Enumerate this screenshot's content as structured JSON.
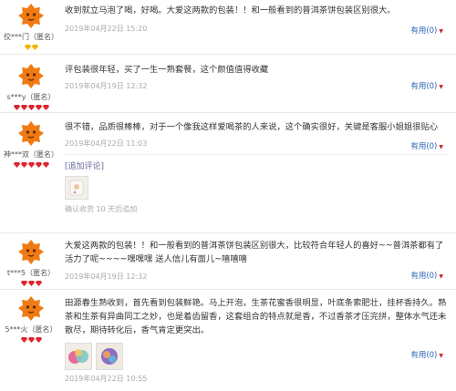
{
  "helpful_label": "有用",
  "helpful_count": "(0)",
  "reviews": [
    {
      "user": "佼***门（匿名）",
      "text": "收到就立马泡了喝，好喝。大爱这两款的包装！！和一般看到的普洱茶饼包装区别很大。",
      "date": "2019年04月22日 15:20"
    },
    {
      "user": "s***y（匿名）",
      "text": "评包装很年轻，买了一生一熟套餐，这个颜值值得收藏",
      "date": "2019年04月19日 12:32"
    },
    {
      "user": "神***双（匿名）",
      "text": "很不错，品质很棒棒，对于一个像我这样爱喝茶的人来说，这个确实很好，关键是客服小姐姐很贴心",
      "date": "2019年04月22日 11:03",
      "append_label": "[追加评论]",
      "append_date": "确认收货 10 天后追加"
    },
    {
      "user": "t***5（匿名）",
      "text": "大爱这两款的包装！！和一般看到的普洱茶饼包装区别很大，比较符合年轻人的喜好~~普洱茶都有了活力了呢~~~~嘿嘿嘿 送人信儿有面儿~嘻嘻嘻",
      "date": "2019年04月19日 12:32"
    },
    {
      "user": "5***火（匿名）",
      "text": "田源春生熟收到，首先看到包装鲜艳。马上开泡，生茶花蜜香很明显，叶底条索肥壮，挂杯香持久。熟茶和生茶有异曲同工之妙，也是着齿留香，这套组合的特点就是香，不过香茶才压完拼，整体水气还未散尽，期待转化后，香气肯定更突出。",
      "date": "2019年04月22日 10:55"
    }
  ]
}
